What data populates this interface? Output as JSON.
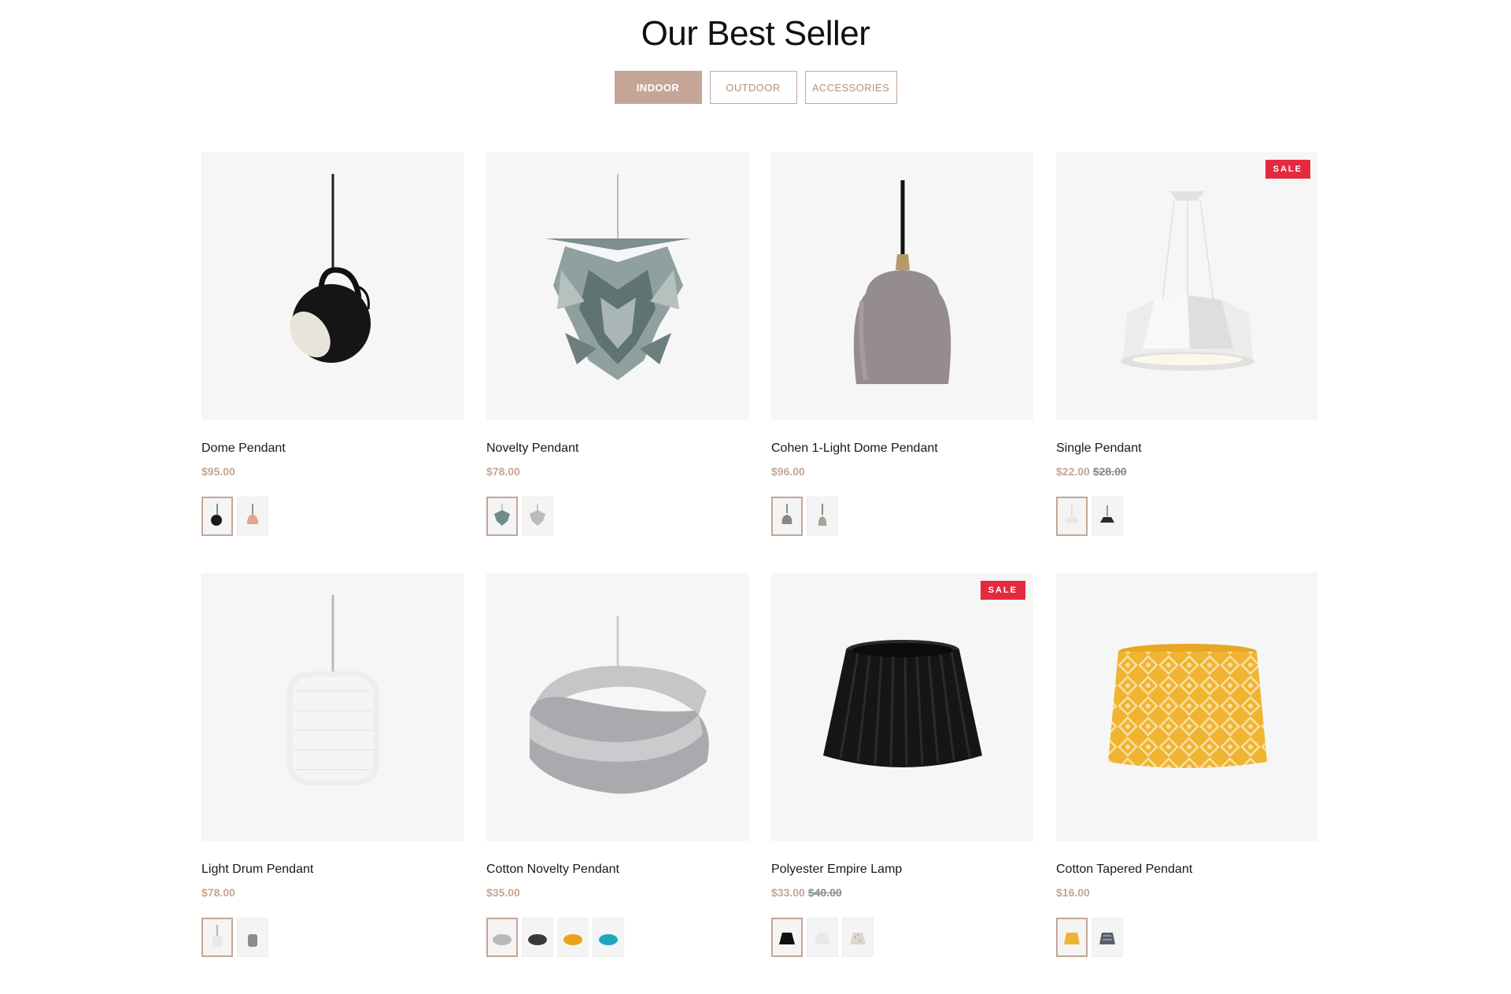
{
  "section": {
    "title": "Our Best Seller"
  },
  "tabs": [
    {
      "label": "INDOOR",
      "active": true
    },
    {
      "label": "OUTDOOR",
      "active": false
    },
    {
      "label": "ACCESSORIES",
      "active": false
    }
  ],
  "colors": {
    "accent": "#c4a596",
    "sale": "#e42a3f",
    "price_old": "#8a8a8a",
    "thumb_bg": "#f6f6f6"
  },
  "products": [
    {
      "name": "Dome Pendant",
      "price": "$95.00",
      "old_price": "",
      "sale_badge": "",
      "image_icon": "black-dome-pendant-icon",
      "swatches": [
        {
          "icon": "black-pendant-swatch-icon",
          "color": "#1a1a1a",
          "selected": true
        },
        {
          "icon": "copper-pendant-swatch-icon",
          "color": "#e0a689",
          "selected": false
        }
      ]
    },
    {
      "name": "Novelty Pendant",
      "price": "$78.00",
      "old_price": "",
      "sale_badge": "",
      "image_icon": "pinecone-pendant-icon",
      "swatches": [
        {
          "icon": "teal-pinecone-swatch-icon",
          "color": "#6f8c8a",
          "selected": true
        },
        {
          "icon": "white-pinecone-swatch-icon",
          "color": "#b8bcbd",
          "selected": false
        }
      ]
    },
    {
      "name": "Cohen 1-Light Dome Pendant",
      "price": "$96.00",
      "old_price": "",
      "sale_badge": "",
      "image_icon": "mauve-bell-pendant-icon",
      "swatches": [
        {
          "icon": "mauve-bell-swatch-icon",
          "color": "#8f8486",
          "selected": true
        },
        {
          "icon": "sage-bell-swatch-icon",
          "color": "#a5a395",
          "selected": false
        }
      ]
    },
    {
      "name": "Single Pendant",
      "price": "$22.00",
      "old_price": "$28.00",
      "sale_badge": "SALE",
      "image_icon": "white-geometric-pendant-icon",
      "swatches": [
        {
          "icon": "white-geometric-swatch-icon",
          "color": "#e6e6e6",
          "selected": true
        },
        {
          "icon": "black-geometric-swatch-icon",
          "color": "#2a2a2a",
          "selected": false
        }
      ]
    },
    {
      "name": "Light Drum Pendant",
      "price": "$78.00",
      "old_price": "",
      "sale_badge": "",
      "image_icon": "white-drum-pendant-icon",
      "swatches": [
        {
          "icon": "white-drum-swatch-icon",
          "color": "#e8e8e8",
          "selected": true
        },
        {
          "icon": "grey-drum-swatch-icon",
          "color": "#8e8a86",
          "selected": false
        }
      ]
    },
    {
      "name": "Cotton Novelty Pendant",
      "price": "$35.00",
      "old_price": "",
      "sale_badge": "",
      "image_icon": "grey-ribbon-pendant-icon",
      "swatches": [
        {
          "icon": "grey-ribbon-swatch-icon",
          "color": "#b8b9bb",
          "selected": true
        },
        {
          "icon": "dark-ribbon-swatch-icon",
          "color": "#3a3a3a",
          "selected": false
        },
        {
          "icon": "yellow-ribbon-swatch-icon",
          "color": "#eba21a",
          "selected": false
        },
        {
          "icon": "teal-ribbon-swatch-icon",
          "color": "#1ea7c2",
          "selected": false
        }
      ]
    },
    {
      "name": "Polyester Empire Lamp",
      "price": "$33.00",
      "old_price": "$40.00",
      "sale_badge": "SALE",
      "image_icon": "black-empire-shade-icon",
      "swatches": [
        {
          "icon": "black-shade-swatch-icon",
          "color": "#111111",
          "selected": true
        },
        {
          "icon": "white-shade-swatch-icon",
          "color": "#e9e9e9",
          "selected": false
        },
        {
          "icon": "patterned-shade-swatch-icon",
          "color": "#dcd6cf",
          "selected": false
        }
      ]
    },
    {
      "name": "Cotton Tapered Pendant",
      "price": "$16.00",
      "old_price": "",
      "sale_badge": "",
      "image_icon": "yellow-patterned-shade-icon",
      "swatches": [
        {
          "icon": "yellow-shade-swatch-icon",
          "color": "#eeb431",
          "selected": true
        },
        {
          "icon": "navy-patterned-shade-swatch-icon",
          "color": "#5a5f6e",
          "selected": false
        }
      ]
    }
  ]
}
